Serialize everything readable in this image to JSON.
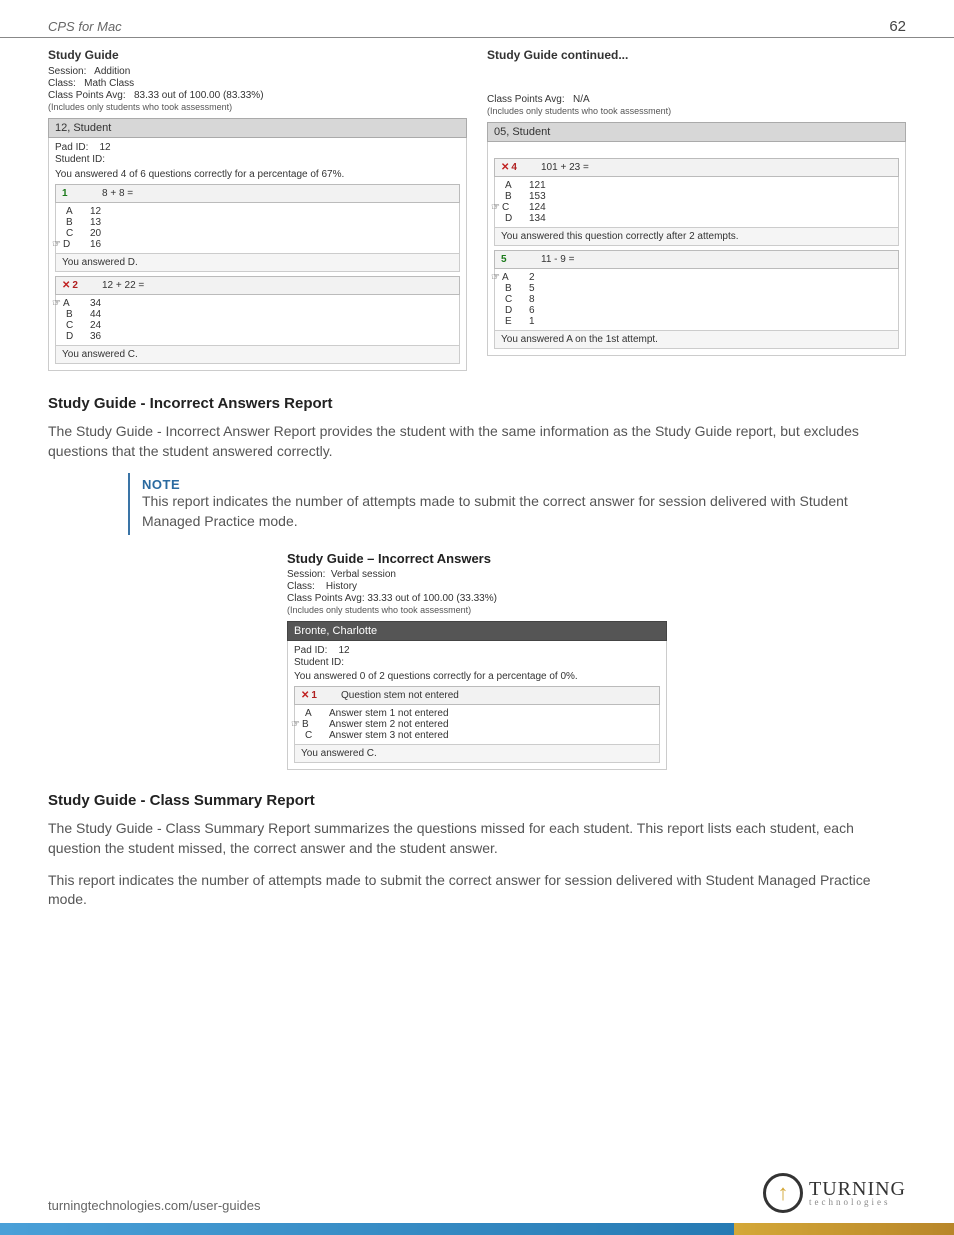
{
  "header": {
    "title": "CPS for Mac",
    "page_number": "62"
  },
  "study_guide": {
    "left": {
      "title": "Study Guide",
      "session_label": "Session:",
      "session_value": "Addition",
      "class_label": "Class:",
      "class_value": "Math Class",
      "points_label": "Class Points Avg:",
      "points_value": "83.33 out of 100.00 (83.33%)",
      "includes_note": "(Includes only students who took assessment)",
      "student_header": "12, Student",
      "pad_label": "Pad ID:",
      "pad_value": "12",
      "studentid_label": "Student ID:",
      "summary": "You answered 4 of 6 questions correctly for a percentage of 67%.",
      "q1": {
        "num": "1",
        "text": "8 + 8 =",
        "answers": [
          [
            "A",
            "12"
          ],
          [
            "B",
            "13"
          ],
          [
            "C",
            "20"
          ],
          [
            "D",
            "16"
          ]
        ],
        "correct_idx": 3,
        "feedback": "You answered D."
      },
      "q2": {
        "num": "2",
        "text": "12 + 22 =",
        "answers": [
          [
            "A",
            "34"
          ],
          [
            "B",
            "44"
          ],
          [
            "C",
            "24"
          ],
          [
            "D",
            "36"
          ]
        ],
        "correct_idx": 0,
        "wrong": true,
        "feedback": "You answered C."
      }
    },
    "right": {
      "title": "Study Guide continued...",
      "points_label": "Class Points Avg:",
      "points_value": "N/A",
      "includes_note": "(Includes only students who took assessment)",
      "student_header": "05, Student",
      "q4": {
        "num": "4",
        "text": "101 + 23 =",
        "answers": [
          [
            "A",
            "121"
          ],
          [
            "B",
            "153"
          ],
          [
            "C",
            "124"
          ],
          [
            "D",
            "134"
          ]
        ],
        "correct_idx": 2,
        "wrong": true,
        "feedback": "You answered this question correctly after 2 attempts."
      },
      "q5": {
        "num": "5",
        "text": "11 - 9 =",
        "answers": [
          [
            "A",
            "2"
          ],
          [
            "B",
            "5"
          ],
          [
            "C",
            "8"
          ],
          [
            "D",
            "6"
          ],
          [
            "E",
            "1"
          ]
        ],
        "correct_idx": 0,
        "feedback": "You answered A on the 1st attempt."
      }
    }
  },
  "section1": {
    "title": "Study Guide - Incorrect Answers Report",
    "body": "The Study Guide - Incorrect Answer Report provides the student with the same information as the Study Guide report, but excludes questions that the student answered correctly."
  },
  "note": {
    "title": "NOTE",
    "body": "This report indicates the number of attempts made to submit the correct answer for session delivered with Student Managed Practice mode."
  },
  "incorrect_sample": {
    "title": "Study Guide – Incorrect Answers",
    "session_label": "Session:",
    "session_value": "Verbal session",
    "class_label": "Class:",
    "class_value": "History",
    "points_line": "Class Points Avg: 33.33 out of 100.00 (33.33%)",
    "includes_note": "(Includes only students who took assessment)",
    "student_header": "Bronte, Charlotte",
    "pad_label": "Pad ID:",
    "pad_value": "12",
    "studentid_label": "Student ID:",
    "summary": "You answered 0 of 2 questions correctly for a percentage of 0%.",
    "q1": {
      "num": "1",
      "text": "Question stem not entered",
      "answers": [
        [
          "A",
          "Answer stem 1 not entered"
        ],
        [
          "B",
          "Answer stem 2 not entered"
        ],
        [
          "C",
          "Answer stem 3 not entered"
        ]
      ],
      "correct_idx": 1,
      "wrong": true,
      "feedback": "You answered C."
    }
  },
  "section2": {
    "title": "Study Guide - Class Summary Report",
    "body1": "The Study Guide - Class Summary Report summarizes the questions missed for each student. This report lists each student, each question the student missed, the correct answer and the student answer.",
    "body2": "This report indicates the number of attempts made to submit the correct answer for session delivered with Student Managed Practice mode."
  },
  "footer": {
    "link": "turningtechnologies.com/user-guides",
    "logo_main": "TURNING",
    "logo_sub": "technologies"
  }
}
